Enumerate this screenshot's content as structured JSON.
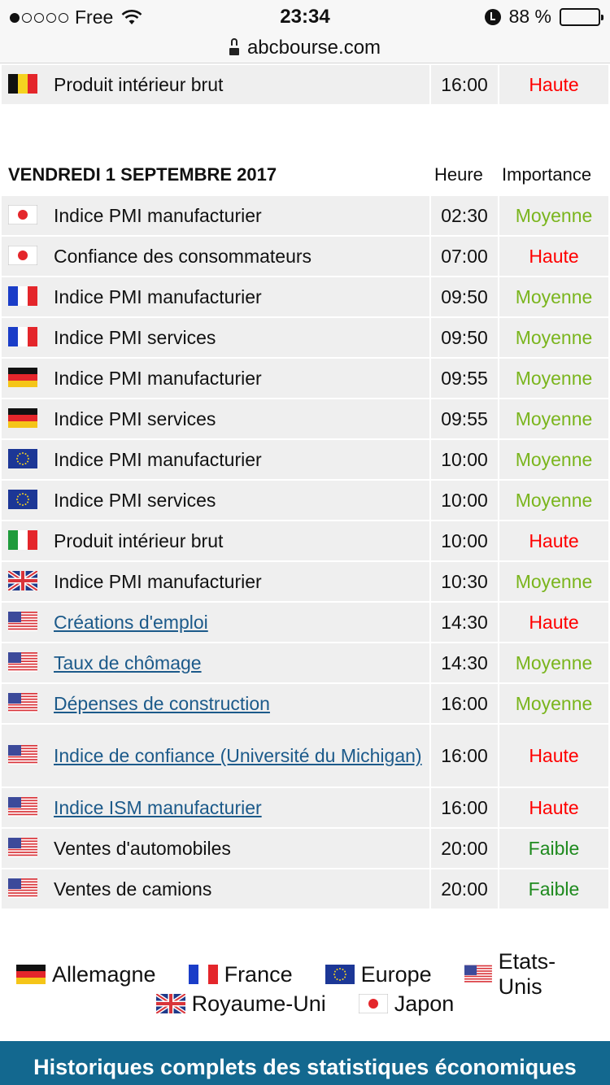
{
  "status_bar": {
    "carrier": "Free",
    "time": "23:34",
    "battery": "88 %",
    "battery_level": 0.88
  },
  "browser": {
    "url": "abcbourse.com"
  },
  "prev_rows": [
    {
      "flag": "BE",
      "event": "Produit intérieur brut",
      "time": "16:00",
      "importance": "Haute"
    }
  ],
  "section": {
    "date": "VENDREDI 1 SEPTEMBRE 2017",
    "col_time": "Heure",
    "col_importance": "Importance",
    "rows": [
      {
        "flag": "JP",
        "event": "Indice PMI manufacturier",
        "time": "02:30",
        "importance": "Moyenne",
        "link": false
      },
      {
        "flag": "JP",
        "event": "Confiance des consommateurs",
        "time": "07:00",
        "importance": "Haute",
        "link": false
      },
      {
        "flag": "FR",
        "event": "Indice PMI manufacturier",
        "time": "09:50",
        "importance": "Moyenne",
        "link": false
      },
      {
        "flag": "FR",
        "event": "Indice PMI services",
        "time": "09:50",
        "importance": "Moyenne",
        "link": false
      },
      {
        "flag": "DE",
        "event": "Indice PMI manufacturier",
        "time": "09:55",
        "importance": "Moyenne",
        "link": false
      },
      {
        "flag": "DE",
        "event": "Indice PMI services",
        "time": "09:55",
        "importance": "Moyenne",
        "link": false
      },
      {
        "flag": "EU",
        "event": "Indice PMI manufacturier",
        "time": "10:00",
        "importance": "Moyenne",
        "link": false
      },
      {
        "flag": "EU",
        "event": "Indice PMI services",
        "time": "10:00",
        "importance": "Moyenne",
        "link": false
      },
      {
        "flag": "IT",
        "event": "Produit intérieur brut",
        "time": "10:00",
        "importance": "Haute",
        "link": false
      },
      {
        "flag": "UK",
        "event": "Indice PMI manufacturier",
        "time": "10:30",
        "importance": "Moyenne",
        "link": false
      },
      {
        "flag": "US",
        "event": "Créations d'emploi",
        "time": "14:30",
        "importance": "Haute",
        "link": true
      },
      {
        "flag": "US",
        "event": "Taux de chômage",
        "time": "14:30",
        "importance": "Moyenne",
        "link": true
      },
      {
        "flag": "US",
        "event": "Dépenses de construction",
        "time": "16:00",
        "importance": "Moyenne",
        "link": true
      },
      {
        "flag": "US",
        "event": "Indice de confiance (Université du Michigan)",
        "time": "16:00",
        "importance": "Haute",
        "link": true
      },
      {
        "flag": "US",
        "event": "Indice ISM manufacturier",
        "time": "16:00",
        "importance": "Haute",
        "link": true
      },
      {
        "flag": "US",
        "event": "Ventes d'automobiles",
        "time": "20:00",
        "importance": "Faible",
        "link": false
      },
      {
        "flag": "US",
        "event": "Ventes de camions",
        "time": "20:00",
        "importance": "Faible",
        "link": false
      }
    ]
  },
  "legend": {
    "row1": [
      {
        "flag": "DE",
        "label": "Allemagne"
      },
      {
        "flag": "FR",
        "label": "France"
      },
      {
        "flag": "EU",
        "label": "Europe"
      },
      {
        "flag": "US",
        "label": "Etats-Unis"
      }
    ],
    "row2": [
      {
        "flag": "UK",
        "label": "Royaume-Uni"
      },
      {
        "flag": "JP",
        "label": "Japon"
      }
    ]
  },
  "footer": {
    "button_label": "Historiques complets des statistiques économiques"
  },
  "colors": {
    "haute": "#ff0000",
    "moyenne": "#7ab51d",
    "faible": "#1e8a1e",
    "link": "#1c5a8a",
    "footer_bg": "#13688f"
  }
}
